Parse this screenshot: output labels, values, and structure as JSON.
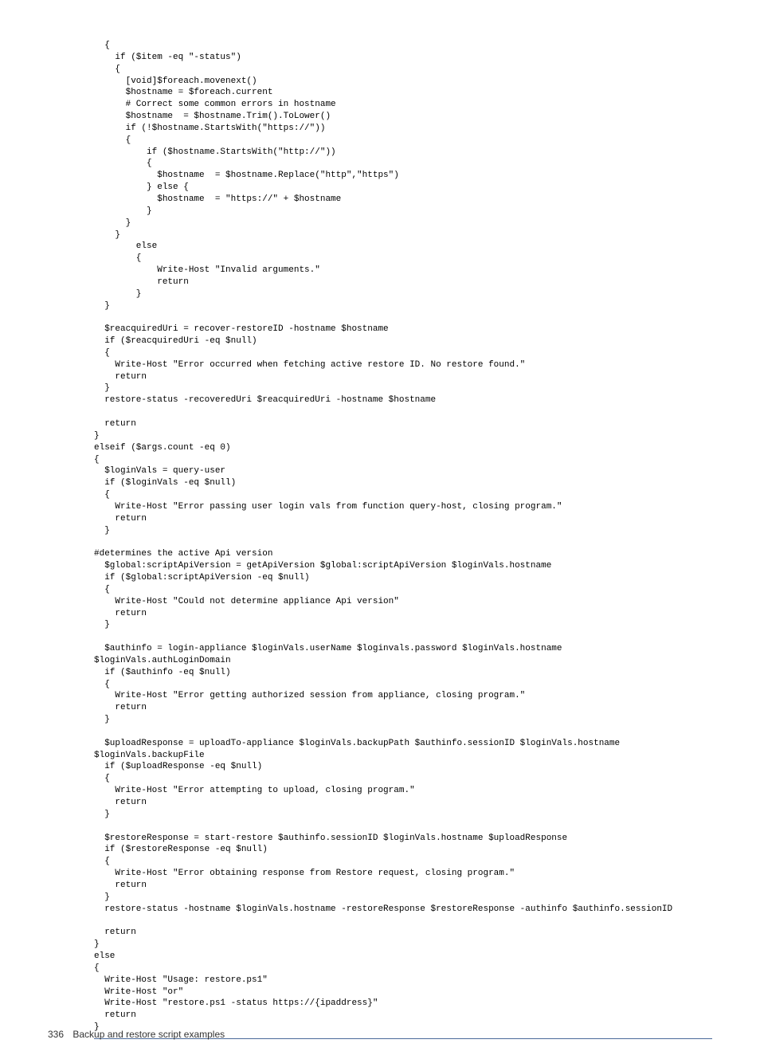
{
  "code": "  {\n    if ($item -eq \"-status\")\n    {\n      [void]$foreach.movenext()\n      $hostname = $foreach.current\n      # Correct some common errors in hostname\n      $hostname  = $hostname.Trim().ToLower()\n      if (!$hostname.StartsWith(\"https://\"))\n      {\n          if ($hostname.StartsWith(\"http://\"))\n          {\n            $hostname  = $hostname.Replace(\"http\",\"https\")\n          } else {\n            $hostname  = \"https://\" + $hostname\n          }\n      }\n    }\n        else\n        {\n            Write-Host \"Invalid arguments.\"\n            return\n        }\n  }\n\n  $reacquiredUri = recover-restoreID -hostname $hostname\n  if ($reacquiredUri -eq $null)\n  {\n    Write-Host \"Error occurred when fetching active restore ID. No restore found.\"\n    return\n  }\n  restore-status -recoveredUri $reacquiredUri -hostname $hostname\n\n  return\n}\nelseif ($args.count -eq 0)\n{\n  $loginVals = query-user\n  if ($loginVals -eq $null)\n  {\n    Write-Host \"Error passing user login vals from function query-host, closing program.\"\n    return\n  }\n\n#determines the active Api version\n  $global:scriptApiVersion = getApiVersion $global:scriptApiVersion $loginVals.hostname\n  if ($global:scriptApiVersion -eq $null)\n  {\n    Write-Host \"Could not determine appliance Api version\"\n    return\n  }\n\n  $authinfo = login-appliance $loginVals.userName $loginvals.password $loginVals.hostname\n$loginVals.authLoginDomain\n  if ($authinfo -eq $null)\n  {\n    Write-Host \"Error getting authorized session from appliance, closing program.\"\n    return\n  }\n\n  $uploadResponse = uploadTo-appliance $loginVals.backupPath $authinfo.sessionID $loginVals.hostname\n$loginVals.backupFile\n  if ($uploadResponse -eq $null)\n  {\n    Write-Host \"Error attempting to upload, closing program.\"\n    return\n  }\n\n  $restoreResponse = start-restore $authinfo.sessionID $loginVals.hostname $uploadResponse\n  if ($restoreResponse -eq $null)\n  {\n    Write-Host \"Error obtaining response from Restore request, closing program.\"\n    return\n  }\n  restore-status -hostname $loginVals.hostname -restoreResponse $restoreResponse -authinfo $authinfo.sessionID\n\n  return\n}\nelse\n{\n  Write-Host \"Usage: restore.ps1\"\n  Write-Host \"or\"\n  Write-Host \"restore.ps1 -status https://{ipaddress}\"\n  return\n}",
  "footer": {
    "page_number": "336",
    "section": "Backup and restore script examples"
  }
}
